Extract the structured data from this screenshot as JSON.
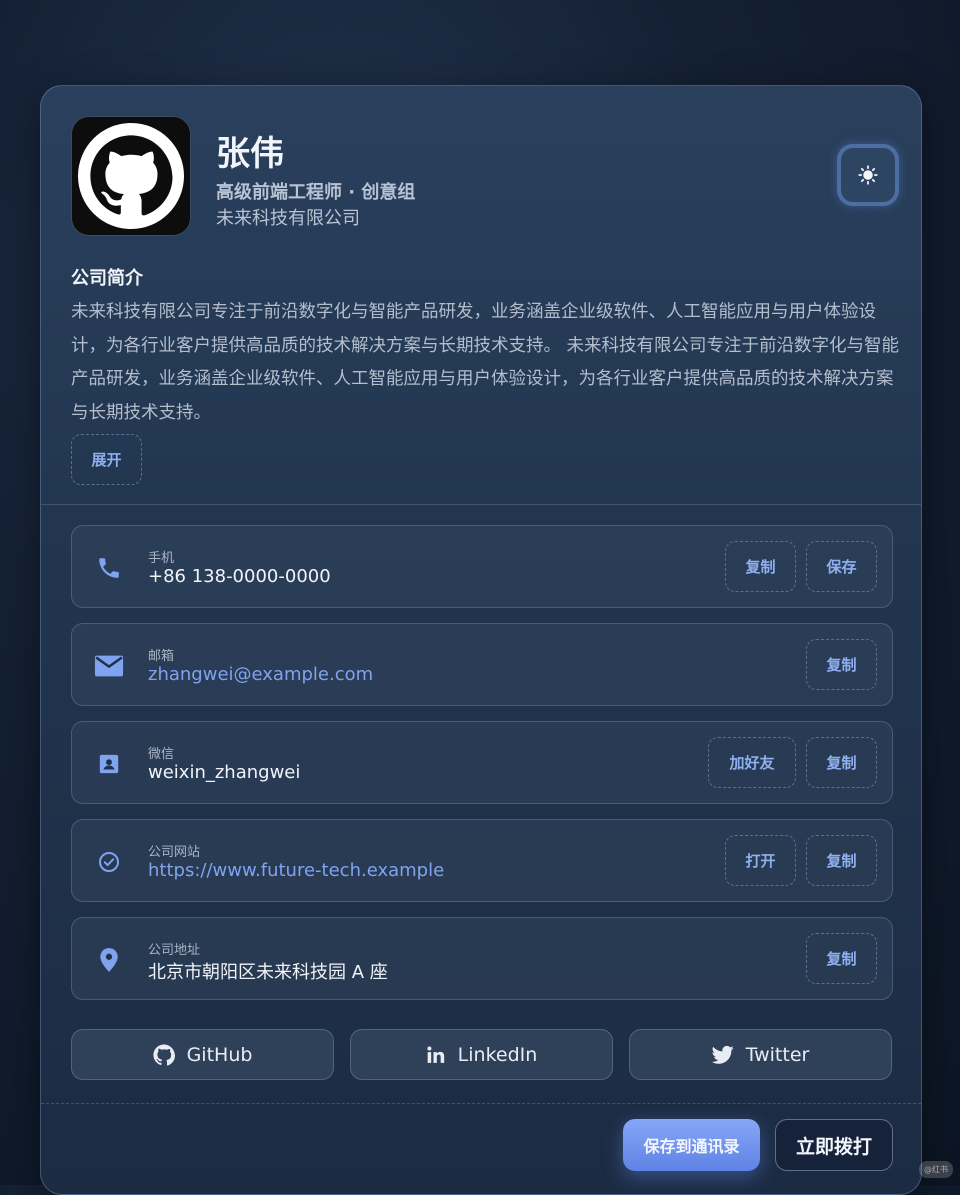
{
  "profile": {
    "name": "张伟",
    "title": "高级前端工程师 · 创意组",
    "company": "未来科技有限公司"
  },
  "about": {
    "heading": "公司简介",
    "text": "未来科技有限公司专注于前沿数字化与智能产品研发，业务涵盖企业级软件、人工智能应用与用户体验设计，为各行业客户提供高品质的技术解决方案与长期技术支持。 未来科技有限公司专注于前沿数字化与智能产品研发，业务涵盖企业级软件、人工智能应用与用户体验设计，为各行业客户提供高品质的技术解决方案与长期技术支持。",
    "expand_label": "展开"
  },
  "contacts": [
    {
      "label": "手机",
      "value": "+86 138-0000-0000",
      "icon": "phone-icon",
      "actions": [
        "复制",
        "保存"
      ]
    },
    {
      "label": "邮箱",
      "value": "zhangwei@example.com",
      "icon": "mail-icon",
      "actions": [
        "复制"
      ]
    },
    {
      "label": "微信",
      "value": "weixin_zhangwei",
      "icon": "contact-card-icon",
      "actions": [
        "加好友",
        "复制"
      ]
    },
    {
      "label": "公司网站",
      "value": "https://www.future-tech.example",
      "icon": "verified-check-icon",
      "actions": [
        "打开",
        "复制"
      ]
    },
    {
      "label": "公司地址",
      "value": "北京市朝阳区未来科技园 A 座",
      "icon": "location-pin-icon",
      "actions": [
        "复制"
      ]
    }
  ],
  "social": [
    {
      "label": "GitHub",
      "icon": "github-icon"
    },
    {
      "label": "LinkedIn",
      "icon": "linkedin-icon"
    },
    {
      "label": "Twitter",
      "icon": "twitter-icon"
    }
  ],
  "footer": {
    "save_contact": "保存到通讯录",
    "call_now": "立即拨打"
  },
  "watermark": "@红书",
  "colors": {
    "accent": "#7fa3ee",
    "primary_button": "#6f92ee",
    "card_bg": "#223650",
    "page_bg": "#142034"
  }
}
